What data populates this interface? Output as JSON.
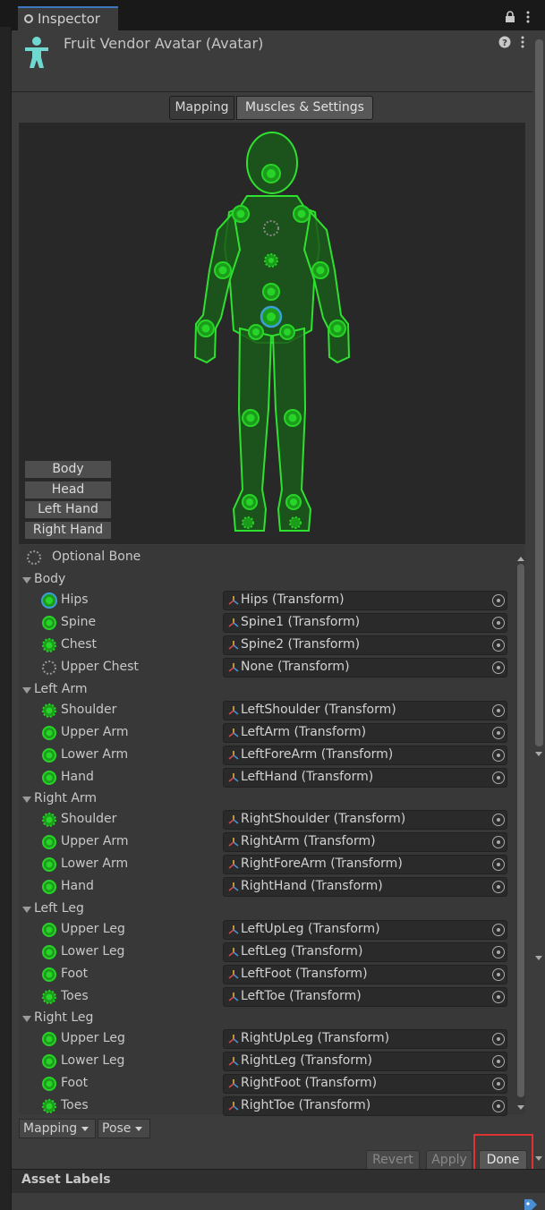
{
  "tab": {
    "title": "Inspector"
  },
  "header": {
    "title": "Fruit Vendor Avatar (Avatar)"
  },
  "mode_tabs": {
    "mapping": "Mapping",
    "muscles": "Muscles & Settings"
  },
  "viewport_buttons": [
    "Body",
    "Head",
    "Left Hand",
    "Right Hand"
  ],
  "legend": {
    "optional_bone": "Optional Bone"
  },
  "groups": {
    "body": "Body",
    "left_arm": "Left Arm",
    "right_arm": "Right Arm",
    "left_leg": "Left Leg",
    "right_leg": "Right Leg"
  },
  "bones": {
    "hips": {
      "label": "Hips",
      "value": "Hips (Transform)"
    },
    "spine": {
      "label": "Spine",
      "value": "Spine1 (Transform)"
    },
    "chest": {
      "label": "Chest",
      "value": "Spine2 (Transform)"
    },
    "upper_chest": {
      "label": "Upper Chest",
      "value": "None (Transform)"
    },
    "la_shoulder": {
      "label": "Shoulder",
      "value": "LeftShoulder (Transform)"
    },
    "la_upper": {
      "label": "Upper Arm",
      "value": "LeftArm (Transform)"
    },
    "la_lower": {
      "label": "Lower Arm",
      "value": "LeftForeArm (Transform)"
    },
    "la_hand": {
      "label": "Hand",
      "value": "LeftHand (Transform)"
    },
    "ra_shoulder": {
      "label": "Shoulder",
      "value": "RightShoulder (Transform)"
    },
    "ra_upper": {
      "label": "Upper Arm",
      "value": "RightArm (Transform)"
    },
    "ra_lower": {
      "label": "Lower Arm",
      "value": "RightForeArm (Transform)"
    },
    "ra_hand": {
      "label": "Hand",
      "value": "RightHand (Transform)"
    },
    "ll_upper": {
      "label": "Upper Leg",
      "value": "LeftUpLeg (Transform)"
    },
    "ll_lower": {
      "label": "Lower Leg",
      "value": "LeftLeg (Transform)"
    },
    "ll_foot": {
      "label": "Foot",
      "value": "LeftFoot (Transform)"
    },
    "ll_toes": {
      "label": "Toes",
      "value": "LeftToe (Transform)"
    },
    "rl_upper": {
      "label": "Upper Leg",
      "value": "RightUpLeg (Transform)"
    },
    "rl_lower": {
      "label": "Lower Leg",
      "value": "RightLeg (Transform)"
    },
    "rl_foot": {
      "label": "Foot",
      "value": "RightFoot (Transform)"
    },
    "rl_toes": {
      "label": "Toes",
      "value": "RightToe (Transform)"
    }
  },
  "bottom": {
    "mapping": "Mapping",
    "pose": "Pose",
    "revert": "Revert",
    "apply": "Apply",
    "done": "Done"
  },
  "asset_labels": "Asset Labels",
  "colors": {
    "bone_green": "#27d427",
    "selected": "#3a9fd6",
    "accent": "#3a79bb",
    "highlight": "#dd3333"
  }
}
